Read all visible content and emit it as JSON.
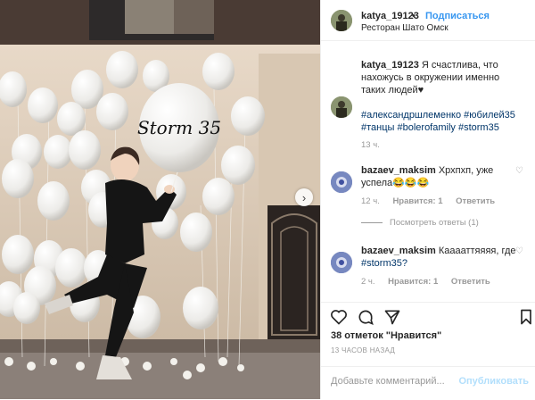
{
  "photo": {
    "balloon_text": "Storm 35",
    "next_icon": "chevron-right-icon"
  },
  "header": {
    "username": "katya_19123",
    "dot": "•",
    "follow_label": "Подписаться",
    "location": "Ресторан Шато Омск"
  },
  "caption": {
    "username": "katya_19123",
    "text": "Я счастлива, что нахожусь в окружении именно таких людей♥",
    "hashtags": "#александршлеменко #юбилей35 #танцы #bolerofamily #storm35",
    "time": "13 ч."
  },
  "comments": [
    {
      "username": "bazaev_maksim",
      "text": "Хрхпхп, уже успела😂😂😂",
      "time": "12 ч.",
      "likes": "Нравится: 1",
      "reply": "Ответить",
      "view_replies": "Посмотреть ответы (1)"
    },
    {
      "username": "bazaev_maksim",
      "text": "Кааааттяяяя, где",
      "tag": "#storm35?",
      "time": "2 ч.",
      "likes": "Нравится: 1",
      "reply": "Ответить"
    }
  ],
  "post": {
    "likes_text": "38 отметок \"Нравится\"",
    "time_ago": "13 ЧАСОВ НАЗАД",
    "comment_placeholder": "Добавьте комментарий...",
    "publish_label": "Опубликовать"
  },
  "colors": {
    "accent": "#3897f0",
    "hashtag": "#003569",
    "muted": "#999999",
    "publish_disabled": "#b2dffc"
  }
}
